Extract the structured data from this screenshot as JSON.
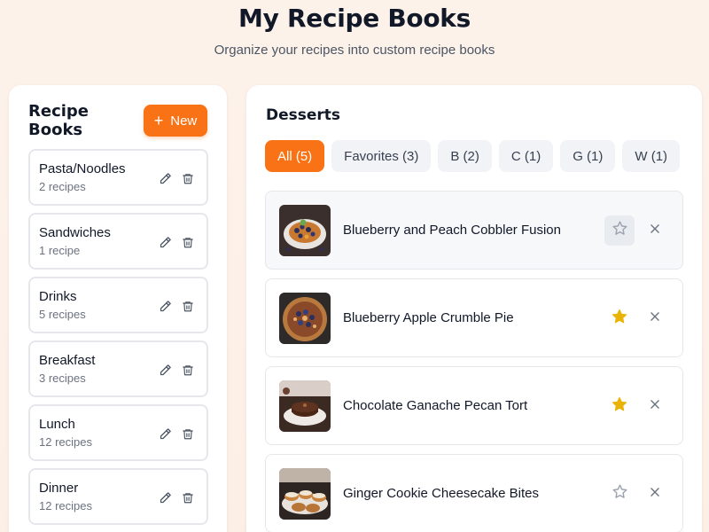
{
  "header": {
    "title": "My Recipe Books",
    "subtitle": "Organize your recipes into custom recipe books"
  },
  "sidebar": {
    "title": "Recipe Books",
    "new_button_icon": "plus-icon",
    "new_button_label": "New",
    "books": [
      {
        "name": "Pasta/Noodles",
        "count": "2 recipes"
      },
      {
        "name": "Sandwiches",
        "count": "1 recipe"
      },
      {
        "name": "Drinks",
        "count": "5 recipes"
      },
      {
        "name": "Breakfast",
        "count": "3 recipes"
      },
      {
        "name": "Lunch",
        "count": "12 recipes"
      },
      {
        "name": "Dinner",
        "count": "12 recipes"
      }
    ]
  },
  "main": {
    "title": "Desserts",
    "tabs": [
      {
        "label": "All (5)",
        "active": true
      },
      {
        "label": "Favorites (3)",
        "active": false
      },
      {
        "label": "B (2)",
        "active": false
      },
      {
        "label": "C (1)",
        "active": false
      },
      {
        "label": "G (1)",
        "active": false
      },
      {
        "label": "W (1)",
        "active": false
      }
    ],
    "recipes": [
      {
        "name": "Blueberry and Peach Cobbler Fusion",
        "favorite": false
      },
      {
        "name": "Blueberry Apple Crumble Pie",
        "favorite": true
      },
      {
        "name": "Chocolate Ganache Pecan Tort",
        "favorite": true
      },
      {
        "name": "Ginger Cookie Cheesecake Bites",
        "favorite": false
      }
    ]
  },
  "colors": {
    "accent": "#f97316",
    "star_filled": "#eab308",
    "star_outline": "#9ca3af",
    "icon_gray": "#6b7280"
  }
}
